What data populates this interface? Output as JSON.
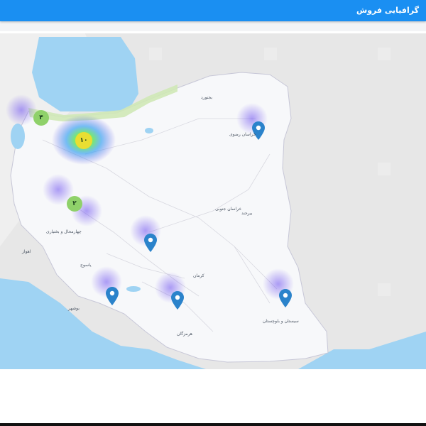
{
  "header": {
    "title": "گرافیایی فروش"
  },
  "map": {
    "colors": {
      "header": "#1a8ff2",
      "water": "#9fd3f3",
      "land": "#f7f8fa",
      "outside_land": "#ececec",
      "marker": "#2b83cb",
      "cluster": "#8fd16a"
    },
    "clusters": [
      {
        "label": "۴"
      },
      {
        "label": "۱۰"
      },
      {
        "label": "۲"
      }
    ],
    "markers": [
      {
        "icon": "map-marker-icon"
      },
      {
        "icon": "map-marker-icon"
      },
      {
        "icon": "map-marker-icon"
      },
      {
        "icon": "map-marker-icon"
      },
      {
        "icon": "map-marker-icon"
      }
    ],
    "places": [
      {
        "name": "بجنورد"
      },
      {
        "name": "خراسان رضوی"
      },
      {
        "name": "خراسان جنوبی"
      },
      {
        "name": "بیرجند"
      },
      {
        "name": "چهارمحال و بختیاری"
      },
      {
        "name": "یاسوج"
      },
      {
        "name": "کرمان"
      },
      {
        "name": "هرمزگان"
      },
      {
        "name": "سیستان و بلوچستان"
      },
      {
        "name": "بوشهر"
      },
      {
        "name": "اهواز"
      }
    ]
  }
}
